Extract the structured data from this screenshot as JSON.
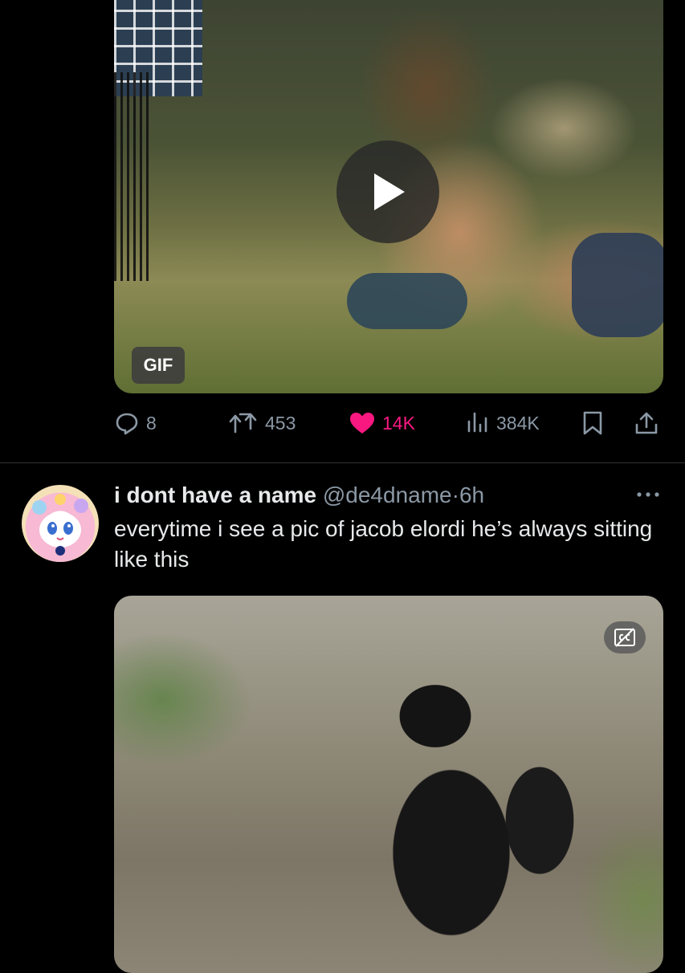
{
  "tweet1": {
    "media_badge": "GIF",
    "stats": {
      "replies": "8",
      "reposts": "453",
      "likes": "14K",
      "views": "384K"
    }
  },
  "tweet2": {
    "display_name": "i dont have a name",
    "handle": "@de4dname",
    "separator": "·",
    "time": "6h",
    "text": "everytime i see a pic of jacob elordi he’s always sitting like this"
  },
  "colors": {
    "background": "#000000",
    "text_primary": "#e7e9ea",
    "text_secondary": "#8b98a5",
    "like_active": "#f91880",
    "divider": "#2f3336"
  },
  "icons": [
    "reply-icon",
    "repost-icon",
    "like-icon",
    "views-icon",
    "bookmark-icon",
    "share-icon",
    "play-icon",
    "more-icon",
    "closed-captions-icon"
  ]
}
